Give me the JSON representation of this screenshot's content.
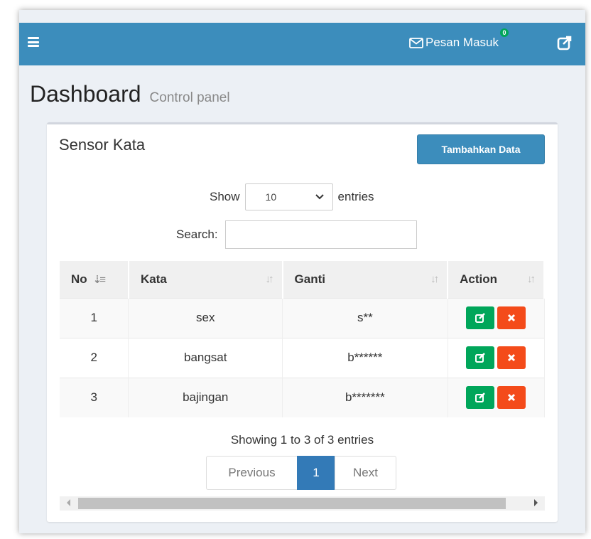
{
  "topbar": {
    "messages_label": "Pesan Masuk",
    "messages_badge": "0",
    "icons": [
      "menu-icon",
      "envelope-icon",
      "external-link-icon"
    ],
    "color": "#3c8dbc"
  },
  "header": {
    "title": "Dashboard",
    "subtitle": "Control panel"
  },
  "box": {
    "title": "Sensor Kata",
    "add_button": "Tambahkan Data"
  },
  "table_controls": {
    "show_label": "Show",
    "page_length": "10",
    "entries_label": "entries",
    "search_label": "Search:",
    "search_value": ""
  },
  "table": {
    "columns": [
      "No",
      "Kata",
      "Ganti",
      "Action"
    ],
    "rows": [
      {
        "no": "1",
        "kata": "sex",
        "ganti": "s**"
      },
      {
        "no": "2",
        "kata": "bangsat",
        "ganti": "b******"
      },
      {
        "no": "3",
        "kata": "bajingan",
        "ganti": "b*******"
      }
    ]
  },
  "footer": {
    "info": "Showing 1 to 3 of 3 entries",
    "previous": "Previous",
    "current_page": "1",
    "next": "Next"
  },
  "colors": {
    "edit": "#00a65a",
    "delete": "#f44b1a",
    "primary": "#3c8dbc"
  }
}
